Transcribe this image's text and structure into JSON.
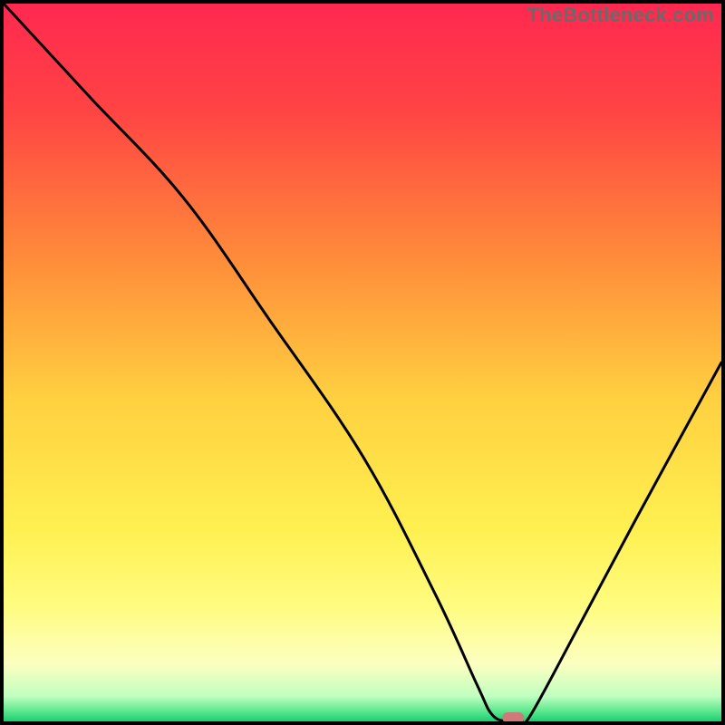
{
  "watermark": "TheBottleneck.com",
  "chart_data": {
    "type": "line",
    "title": "",
    "xlabel": "",
    "ylabel": "",
    "xlim": [
      0,
      100
    ],
    "ylim": [
      0,
      100
    ],
    "grid": false,
    "legend": false,
    "series": [
      {
        "name": "curve",
        "x": [
          0,
          12,
          25,
          37,
          50,
          60,
          66,
          68,
          70,
          72,
          73.5,
          80,
          88,
          100
        ],
        "values": [
          100,
          87,
          73,
          56,
          37,
          18,
          5,
          1,
          0,
          0,
          1,
          13,
          28,
          50
        ],
        "color": "#000000"
      }
    ],
    "minimum_marker": {
      "x": 71,
      "y": 0,
      "color": "#cf7a78"
    },
    "background_gradient": {
      "stops": [
        {
          "pos": 0.0,
          "color": "#ff2850"
        },
        {
          "pos": 0.15,
          "color": "#ff4444"
        },
        {
          "pos": 0.35,
          "color": "#ff8a3a"
        },
        {
          "pos": 0.55,
          "color": "#ffd040"
        },
        {
          "pos": 0.73,
          "color": "#fff050"
        },
        {
          "pos": 0.84,
          "color": "#fffc80"
        },
        {
          "pos": 0.92,
          "color": "#fcffc0"
        },
        {
          "pos": 0.965,
          "color": "#c0ffc0"
        },
        {
          "pos": 0.985,
          "color": "#60e890"
        },
        {
          "pos": 1.0,
          "color": "#18d070"
        }
      ]
    }
  }
}
